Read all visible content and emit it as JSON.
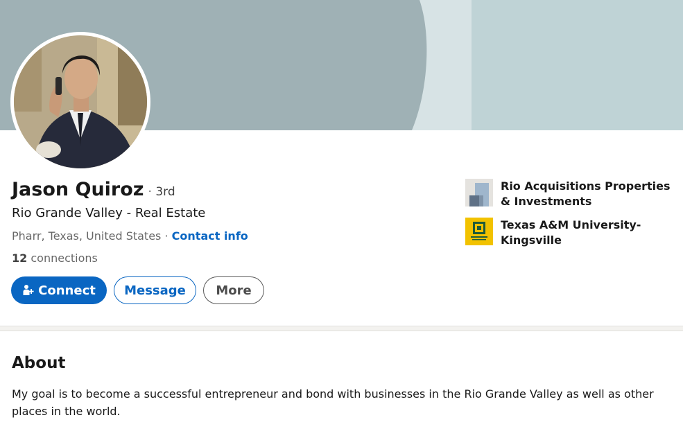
{
  "profile": {
    "name": "Jason Quiroz",
    "degree_separator": "·",
    "degree": "3rd",
    "headline": "Rio Grande Valley - Real Estate",
    "location": "Pharr, Texas, United States",
    "location_separator": "·",
    "contact_info_label": "Contact info",
    "connections_count": "12",
    "connections_label": "connections"
  },
  "actions": {
    "connect_label": "Connect",
    "message_label": "Message",
    "more_label": "More"
  },
  "right_rail": {
    "items": [
      {
        "label": "Rio Acquisitions Properties & Investments",
        "icon": "company-logo-icon"
      },
      {
        "label": "Texas A&M University-Kingsville",
        "icon": "university-logo-icon"
      }
    ]
  },
  "about": {
    "title": "About",
    "text": "My goal is to become a successful entrepreneur and bond with businesses in the Rio Grande Valley as well as other places in the world."
  },
  "colors": {
    "accent": "#0a66c2",
    "cover_dark": "#9fb1b5",
    "cover_light": "#d7e3e5",
    "cover_right": "#bfd3d6",
    "page_divider": "#f3f2ef"
  }
}
